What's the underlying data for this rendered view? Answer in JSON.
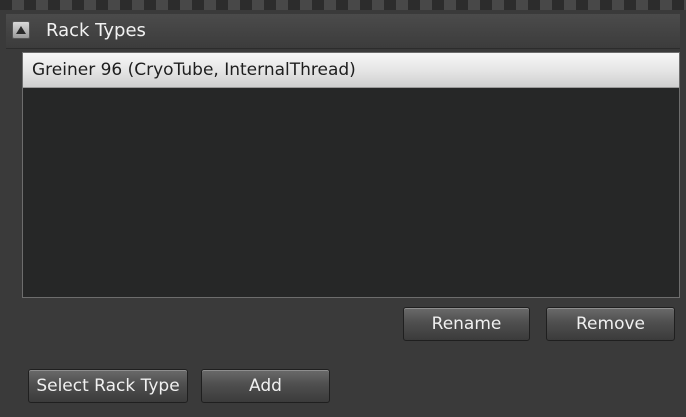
{
  "header": {
    "title": "Rack Types",
    "collapse_icon": "triangle-up-icon"
  },
  "rack_list": {
    "items": [
      {
        "label": "Greiner 96 (CryoTube, InternalThread)",
        "selected": true
      }
    ]
  },
  "actions": {
    "rename_label": "Rename",
    "remove_label": "Remove",
    "select_label": "Select Rack Type",
    "add_label": "Add"
  },
  "colors": {
    "panel_bg": "#3a3a3a",
    "list_bg": "#262727",
    "selected_item_bg": "#e6e6e6",
    "button_bg": "#4f4f4f",
    "text_light": "#f0f0f0"
  }
}
